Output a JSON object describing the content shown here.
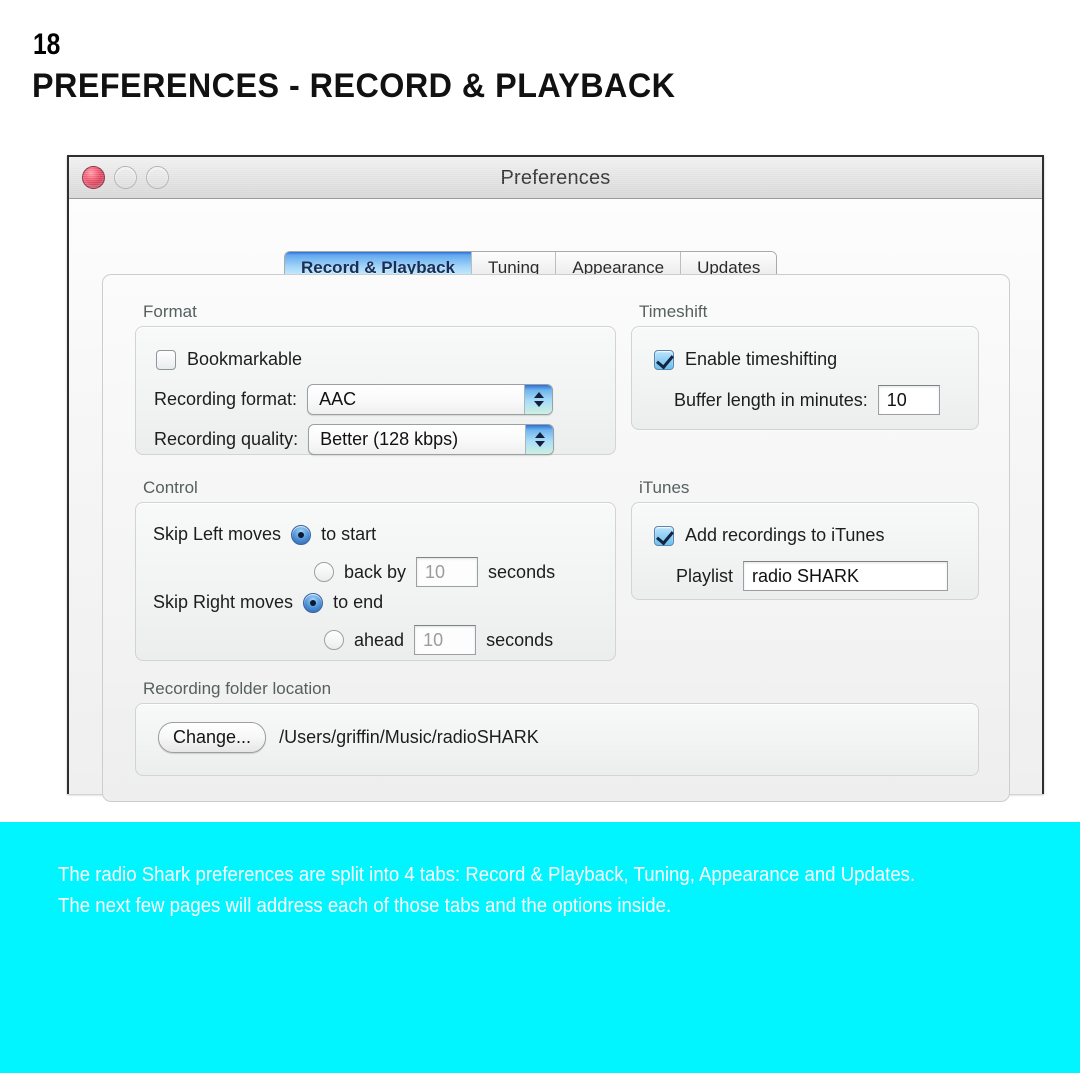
{
  "page": {
    "number": "18",
    "title": "PREFERENCES - RECORD & PLAYBACK"
  },
  "window": {
    "title": "Preferences",
    "traffic_lights": {
      "close": "close-button",
      "minimize": "minimize-button",
      "zoom": "zoom-button"
    }
  },
  "tabs": [
    {
      "label": "Record & Playback",
      "active": true
    },
    {
      "label": "Tuning",
      "active": false
    },
    {
      "label": "Appearance",
      "active": false
    },
    {
      "label": "Updates",
      "active": false
    }
  ],
  "groups": {
    "format": {
      "label": "Format",
      "bookmarkable": {
        "label": "Bookmarkable",
        "checked": false
      },
      "recording_format": {
        "label": "Recording format:",
        "value": "AAC"
      },
      "recording_quality": {
        "label": "Recording quality:",
        "value": "Better (128 kbps)"
      }
    },
    "timeshift": {
      "label": "Timeshift",
      "enable": {
        "label": "Enable timeshifting",
        "checked": true
      },
      "buffer": {
        "label": "Buffer length in minutes:",
        "value": "10"
      }
    },
    "control": {
      "label": "Control",
      "skip_left": {
        "label": "Skip Left moves",
        "option_to_start": "to start",
        "option_back_by": "back by",
        "back_by_value": "10",
        "back_by_unit": "seconds",
        "selected": "to start"
      },
      "skip_right": {
        "label": "Skip Right moves",
        "option_to_end": "to end",
        "option_ahead": "ahead",
        "ahead_value": "10",
        "ahead_unit": "seconds",
        "selected": "to end"
      }
    },
    "itunes": {
      "label": "iTunes",
      "add_recordings": {
        "label": "Add recordings to iTunes",
        "checked": true
      },
      "playlist": {
        "label": "Playlist",
        "value": "radio SHARK"
      }
    },
    "folder": {
      "label": "Recording folder location",
      "change_button": "Change...",
      "path": "/Users/griffin/Music/radioSHARK"
    }
  },
  "caption": {
    "line1": "The radio Shark preferences are split into 4 tabs: Record & Playback, Tuning, Appearance and Updates.",
    "line2": "The next few pages will address each of those tabs and the options inside.",
    "background_color": "#00f5ff",
    "text_color": "#ffffff"
  }
}
